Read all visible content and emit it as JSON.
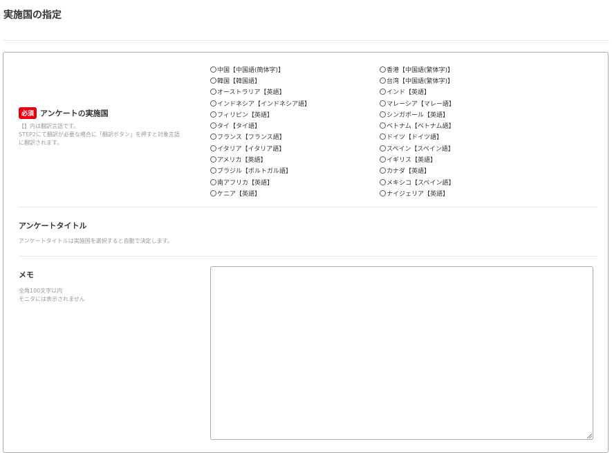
{
  "page": {
    "title": "実施国の指定"
  },
  "survey_country": {
    "required_badge": "必須",
    "label": "アンケートの実施国",
    "help_lines": [
      "【】内は翻訳言語です。",
      "STEP2にて翻訳が必要な場合に「翻訳ボタン」を押すと対象言語",
      "に翻訳されます。"
    ],
    "countries_left": [
      "中国【中国語(簡体字)】",
      "韓国【韓国語】",
      "オーストラリア【英語】",
      "インドネシア【インドネシア語】",
      "フィリピン【英語】",
      "タイ【タイ語】",
      "フランス【フランス語】",
      "イタリア【イタリア語】",
      "アメリカ【英語】",
      "ブラジル【ポルトガル語】",
      "南アフリカ【英語】",
      "ケニア【英語】"
    ],
    "countries_right": [
      "香港【中国語(繁体字)】",
      "台湾【中国語(繁体字)】",
      "インド【英語】",
      "マレーシア【マレー語】",
      "シンガポール【英語】",
      "ベトナム【ベトナム語】",
      "ドイツ【ドイツ語】",
      "スペイン【スペイン語】",
      "イギリス【英語】",
      "カナダ【英語】",
      "メキシコ【スペイン語】",
      "ナイジェリア【英語】"
    ]
  },
  "survey_title": {
    "label": "アンケートタイトル",
    "help": "アンケートタイトルは実施国を選択すると自動で決定します。"
  },
  "memo": {
    "label": "メモ",
    "help_lines": [
      "全角100文字以内",
      "モニタには表示されません"
    ],
    "value": ""
  },
  "colors": {
    "required_badge": "#e60012",
    "border": "#a9a9a9",
    "divider": "#e6e6e6",
    "help_text": "#999999"
  }
}
